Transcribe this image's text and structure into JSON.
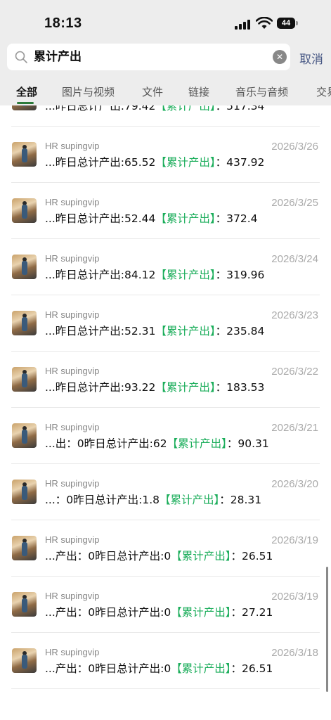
{
  "status": {
    "time": "18:13",
    "battery": "44"
  },
  "search": {
    "query": "累计产出",
    "cancel_label": "取消"
  },
  "tabs": [
    {
      "label": "全部",
      "active": true
    },
    {
      "label": "图片与视频"
    },
    {
      "label": "文件"
    },
    {
      "label": "链接"
    },
    {
      "label": "音乐与音频"
    },
    {
      "label": "交易"
    }
  ],
  "results": [
    {
      "sender": "",
      "date": "",
      "pre": "...昨日总计产出:79.42",
      "highlight": "【累计产出】",
      "post": "：517.34"
    },
    {
      "sender": "HR supingvip",
      "date": "2026/3/26",
      "pre": "...昨日总计产出:65.52",
      "highlight": "【累计产出】",
      "post": "：437.92"
    },
    {
      "sender": "HR supingvip",
      "date": "2026/3/25",
      "pre": "...昨日总计产出:52.44",
      "highlight": "【累计产出】",
      "post": "：372.4"
    },
    {
      "sender": "HR supingvip",
      "date": "2026/3/24",
      "pre": "...昨日总计产出:84.12",
      "highlight": "【累计产出】",
      "post": "：319.96"
    },
    {
      "sender": "HR supingvip",
      "date": "2026/3/23",
      "pre": "...昨日总计产出:52.31",
      "highlight": "【累计产出】",
      "post": "：235.84"
    },
    {
      "sender": "HR supingvip",
      "date": "2026/3/22",
      "pre": "...昨日总计产出:93.22",
      "highlight": "【累计产出】",
      "post": "：183.53"
    },
    {
      "sender": "HR supingvip",
      "date": "2026/3/21",
      "pre": "...出：0昨日总计产出:62",
      "highlight": "【累计产出】",
      "post": "：90.31"
    },
    {
      "sender": "HR supingvip",
      "date": "2026/3/20",
      "pre": "...：0昨日总计产出:1.8",
      "highlight": "【累计产出】",
      "post": "：28.31"
    },
    {
      "sender": "HR supingvip",
      "date": "2026/3/19",
      "pre": "...产出：0昨日总计产出:0",
      "highlight": "【累计产出】",
      "post": "：26.51"
    },
    {
      "sender": "HR supingvip",
      "date": "2026/3/19",
      "pre": "...产出：0昨日总计产出:0",
      "highlight": "【累计产出】",
      "post": "：27.21"
    },
    {
      "sender": "HR supingvip",
      "date": "2026/3/18",
      "pre": "...产出：0昨日总计产出:0",
      "highlight": "【累计产出】",
      "post": "：26.51"
    }
  ]
}
